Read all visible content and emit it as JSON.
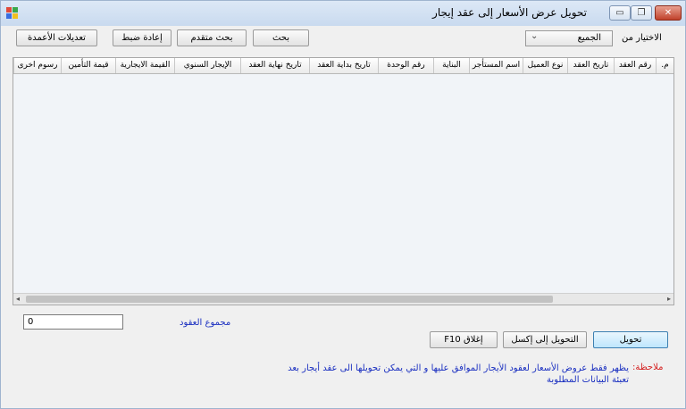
{
  "window": {
    "title": "تحويل عرض الأسعار إلى عقد إيجار",
    "minimize_icon": "minimize-icon",
    "maximize_icon": "maximize-icon",
    "close_icon": "close-icon",
    "close_label": "✕",
    "minimize_label": "▭",
    "maximize_label": "❐"
  },
  "toolbar": {
    "column_edits": "تعديلات الأعمدة",
    "reset": "إعادة ضبط",
    "advanced_search": "بحث متقدم",
    "search": "بحث",
    "filter_label": "الاختيار من",
    "filter_value": "الجميع",
    "filter_arrow": "⌄"
  },
  "grid": {
    "columns": [
      "م.",
      "رقم العقد",
      "تاريخ العقد",
      "نوع العميل",
      "اسم المستأجر",
      "البناية",
      "رقم الوحدة",
      "تاريخ بداية العقد",
      "تاريخ نهاية العقد",
      "الإيجار السنوي",
      "القيمة الايجارية",
      "قيمة التأمين",
      "رسوم اخرى"
    ],
    "scroll_left": "◂",
    "scroll_right": "▸"
  },
  "footer": {
    "contracts_total_label": "مجموع العقود",
    "contracts_total_value": "0",
    "convert_button": "تحويل",
    "export_excel_button": "التحويل إلى إكسل",
    "close_button": "إغلاق F10",
    "note_label": "ملاحظة:",
    "note_text": "يظهر فقط عروض الأسعار لعقود الأيجار الموافق عليها و التي يمكن تحويلها الى عقد أيجار بعد تعبئة البيانات المطلوبة"
  },
  "colors": {
    "note_label": "#d42020",
    "note_text": "#1a2fc0",
    "total_label": "#1a2fc0",
    "grid_background": "#f1f4f8"
  }
}
